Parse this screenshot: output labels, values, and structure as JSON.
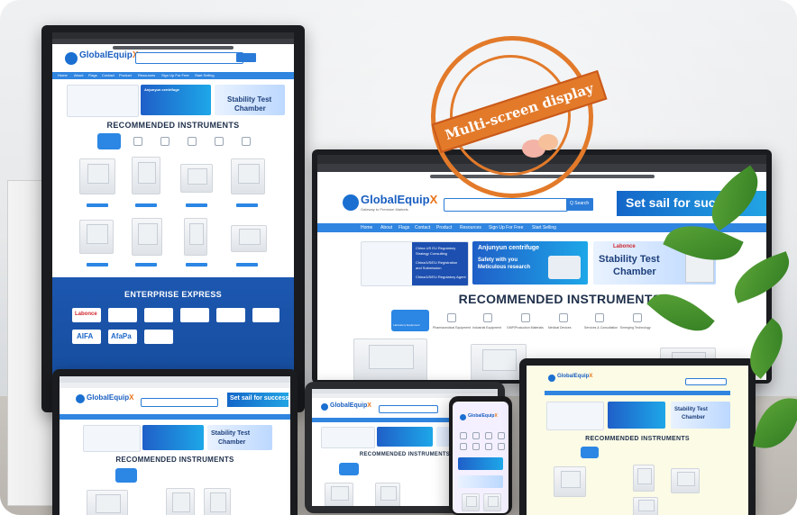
{
  "overlay": {
    "stamp_text": "Multi-screen display"
  },
  "site": {
    "brand": "GlobalEquipX",
    "brand_prefix": "Global",
    "brand_main": "Equip",
    "brand_x": "X",
    "tagline": "Gateway to Premium Markets",
    "search_button": "Q Search",
    "slogan": "Set sail for success",
    "nav": [
      "Home",
      "About",
      "Flags",
      "Contact",
      "Product",
      "Resources",
      "Sign Up For Free",
      "Start Selling"
    ],
    "recommended_title": "RECOMMENDED INSTRUMENTS",
    "enterprise_title": "ENTERPRISE EXPRESS",
    "banners": {
      "regulatory": [
        "China US EU Regulatory",
        "Strategy Consulting",
        "China/US/EU Registration",
        "and Submission",
        "China/US/EU Regulatory Agent"
      ],
      "centrifuge_title": "Anjunyun centrifuge",
      "centrifuge_sub": "Safety with you",
      "centrifuge_sub2": "Meticulous research",
      "stability_brand": "Labonce",
      "stability_line1": "Stability Test",
      "stability_line2": "Chamber"
    },
    "categories": [
      "Laboratory Equipment",
      "Pharmaceutical Equipment",
      "Industrial Equipment",
      "GMP/Production Materials",
      "Medical Devices",
      "Services & Consultation",
      "Emerging Technology"
    ],
    "enterprise_logos": [
      "Labonce",
      "AIFA",
      "AfaPa"
    ]
  },
  "colors": {
    "accent": "#2f85e0",
    "brand_blue": "#1a5fc0",
    "brand_orange": "#e8731a",
    "stamp": "#e27a2a",
    "footer": "#1c57b0"
  }
}
